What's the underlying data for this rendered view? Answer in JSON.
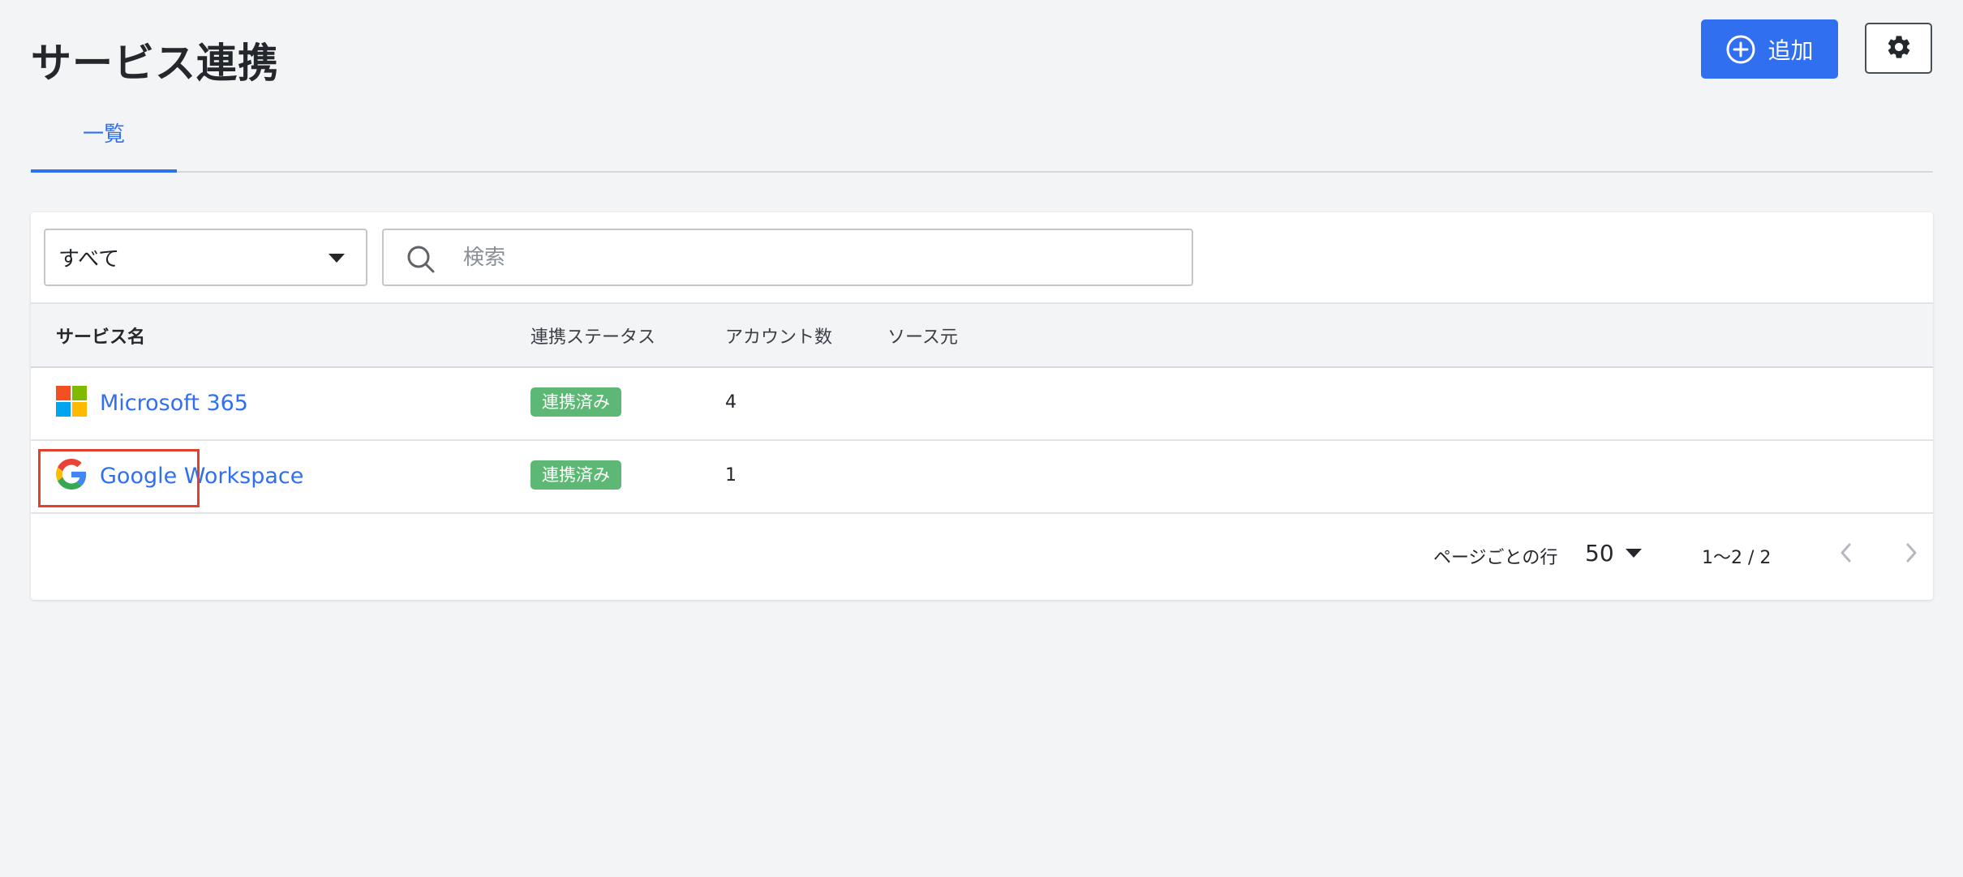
{
  "page": {
    "title": "サービス連携"
  },
  "header": {
    "add_label": "追加",
    "add_icon": "plus-circle-icon",
    "settings_icon": "gear-icon"
  },
  "tabs": [
    {
      "label": "一覧",
      "active": true
    }
  ],
  "filters": {
    "select_value": "すべて",
    "search_placeholder": "検索",
    "search_value": ""
  },
  "table": {
    "columns": [
      "サービス名",
      "連携ステータス",
      "アカウント数",
      "ソース元"
    ],
    "rows": [
      {
        "icon": "microsoft-logo-icon",
        "name": "Microsoft 365",
        "status": "連携済み",
        "accounts": "4",
        "source": ""
      },
      {
        "icon": "google-logo-icon",
        "name": "Google Workspace",
        "status": "連携済み",
        "accounts": "1",
        "source": ""
      }
    ]
  },
  "pagination": {
    "rows_per_page_label": "ページごとの行",
    "rows_per_page_value": "50",
    "range_text": "1〜2 / 2"
  },
  "colors": {
    "accent": "#2f6ff0",
    "status_connected": "#5cb874",
    "highlight": "#e0402e",
    "background": "#f3f4f6"
  }
}
